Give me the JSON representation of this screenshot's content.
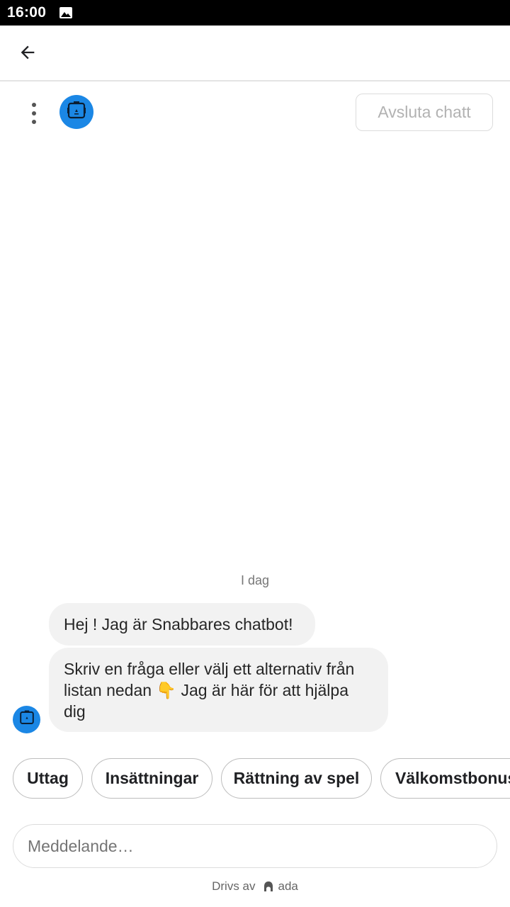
{
  "status_bar": {
    "time": "16:00",
    "icons": [
      "image-icon"
    ]
  },
  "app_bar": {
    "back_icon": "arrow-back-icon"
  },
  "chat_header": {
    "menu_icon": "more-vertical-icon",
    "avatar_icon": "bot-avatar-icon",
    "end_chat_label": "Avsluta chatt"
  },
  "conversation": {
    "date_label": "I dag",
    "messages": [
      {
        "sender": "bot",
        "text": "Hej ! Jag är Snabbares chatbot!"
      },
      {
        "sender": "bot",
        "text": "Skriv en fråga eller välj ett alternativ från listan nedan 👇 Jag är här för att hjälpa dig"
      }
    ]
  },
  "quick_replies": [
    "Uttag",
    "Insättningar",
    "Rättning av spel",
    "Välkomstbonus"
  ],
  "composer": {
    "placeholder": "Meddelande…",
    "value": ""
  },
  "footer": {
    "powered_by_label": "Drivs av",
    "brand": "ada"
  },
  "colors": {
    "accent": "#1b87e5",
    "bubble_bg": "#f2f2f2",
    "disabled_text": "#b2b2b2"
  }
}
